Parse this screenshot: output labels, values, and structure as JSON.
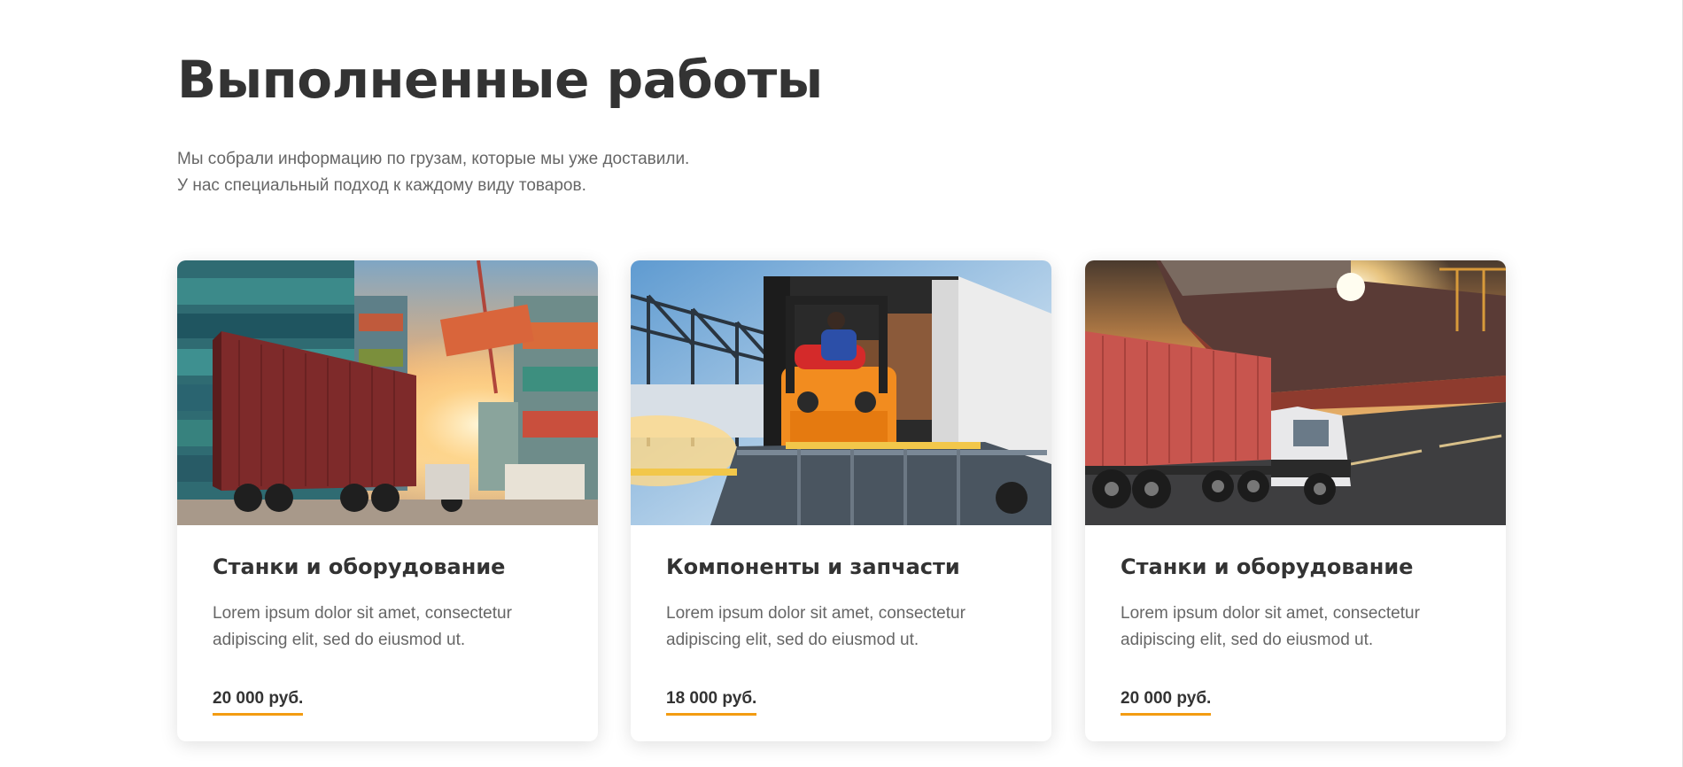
{
  "section": {
    "title": "Выполненные работы",
    "subtitle_lines": [
      "Мы собрали информацию по грузам, которые мы уже доставили.",
      "У нас специальный подход к каждому виду товаров."
    ]
  },
  "cards": [
    {
      "title": "Станки и оборудование",
      "text": "Lorem ipsum dolor sit amet, consectetur adipiscing elit, sed do eiusmod ut.",
      "price": "20 000 руб.",
      "image": "container-port-truck-photo"
    },
    {
      "title": "Компоненты и запчасти",
      "text": "Lorem ipsum dolor sit amet, consectetur adipiscing elit, sed do eiusmod ut.",
      "price": "18 000 руб.",
      "image": "forklift-loading-truck-photo"
    },
    {
      "title": "Станки и оборудование",
      "text": "Lorem ipsum dolor sit amet, consectetur adipiscing elit, sed do eiusmod ut.",
      "price": "20 000 руб.",
      "image": "cargo-ship-truck-photo"
    }
  ],
  "colors": {
    "accent": "#f39c12",
    "heading": "#333333",
    "body_text": "#666666"
  }
}
